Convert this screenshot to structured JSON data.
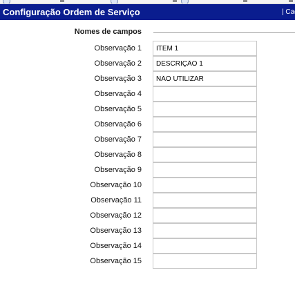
{
  "window": {
    "title": "Configuração Ordem de Serviço",
    "right_link": "| Cad"
  },
  "toolbar_icons": [
    "refresh-icon",
    "document-icon",
    "refresh-icon",
    "document-icon",
    "refresh-icon",
    "document-icon",
    "arrow-icon"
  ],
  "section": {
    "label": "Nomes de campos"
  },
  "fields": [
    {
      "label": "Observação 1",
      "value": "ITEM 1"
    },
    {
      "label": "Observação 2",
      "value": "DESCRIÇÃO 1"
    },
    {
      "label": "Observação 3",
      "value": "NÃO UTILIZAR"
    },
    {
      "label": "Observação 4",
      "value": ""
    },
    {
      "label": "Observação 5",
      "value": ""
    },
    {
      "label": "Observação 6",
      "value": ""
    },
    {
      "label": "Observação 7",
      "value": ""
    },
    {
      "label": "Observação 8",
      "value": ""
    },
    {
      "label": "Observação 9",
      "value": ""
    },
    {
      "label": "Observação 10",
      "value": ""
    },
    {
      "label": "Observação 11",
      "value": ""
    },
    {
      "label": "Observação 12",
      "value": ""
    },
    {
      "label": "Observação 13",
      "value": ""
    },
    {
      "label": "Observação 14",
      "value": ""
    },
    {
      "label": "Observação 15",
      "value": ""
    }
  ],
  "colors": {
    "title_bar": "#0a1d8f",
    "title_text": "#ffffff",
    "input_border": "#c8c8c8"
  }
}
